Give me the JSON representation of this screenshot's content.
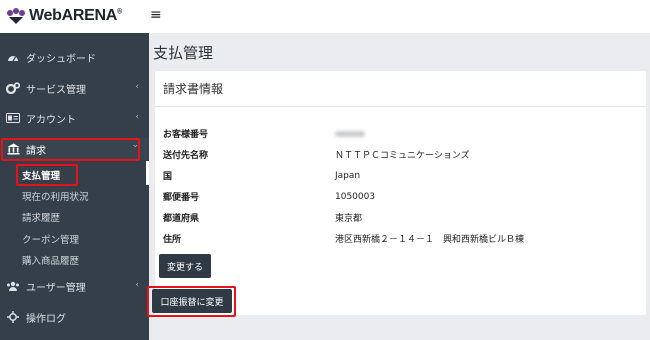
{
  "app": {
    "logo_text": "WebARENA",
    "logo_mark": "®",
    "menu_icon": "hamburger-icon"
  },
  "sidebar": {
    "items": [
      {
        "label": "ダッシュボード",
        "icon": "dashboard-icon"
      },
      {
        "label": "サービス管理",
        "icon": "cogs-icon",
        "chevron": "‹"
      },
      {
        "label": "アカウント",
        "icon": "id-card-icon",
        "chevron": "‹"
      },
      {
        "label": "請求",
        "icon": "bank-icon",
        "chevron": "⌄"
      },
      {
        "label": "ユーザー管理",
        "icon": "users-icon",
        "chevron": "‹"
      },
      {
        "label": "操作ログ",
        "icon": "crosshair-icon"
      }
    ],
    "billing_sub": [
      {
        "label": "支払管理",
        "current": true
      },
      {
        "label": "現在の利用状況"
      },
      {
        "label": "請求履歴"
      },
      {
        "label": "クーポン管理"
      },
      {
        "label": "購入商品履歴"
      }
    ]
  },
  "main": {
    "page_title": "支払管理",
    "card_title": "請求書情報",
    "fields": [
      {
        "label": "お客様番号",
        "value": ""
      },
      {
        "label": "送付先名称",
        "value": "ＮＴＴＰＣコミュニケーションズ"
      },
      {
        "label": "国",
        "value": "Japan"
      },
      {
        "label": "郵便番号",
        "value": "1050003"
      },
      {
        "label": "都道府県",
        "value": "東京都"
      },
      {
        "label": "住所",
        "value": "港区西新橋２－１４－１　興和西新橋ビルＢ棟"
      }
    ],
    "change_button": "変更する",
    "bank_transfer_button": "口座振替に変更"
  },
  "colors": {
    "sidebar_bg": "#353f49",
    "button_bg": "#2f3a45",
    "highlight_red": "#e5121a",
    "page_bg": "#eaecef"
  }
}
